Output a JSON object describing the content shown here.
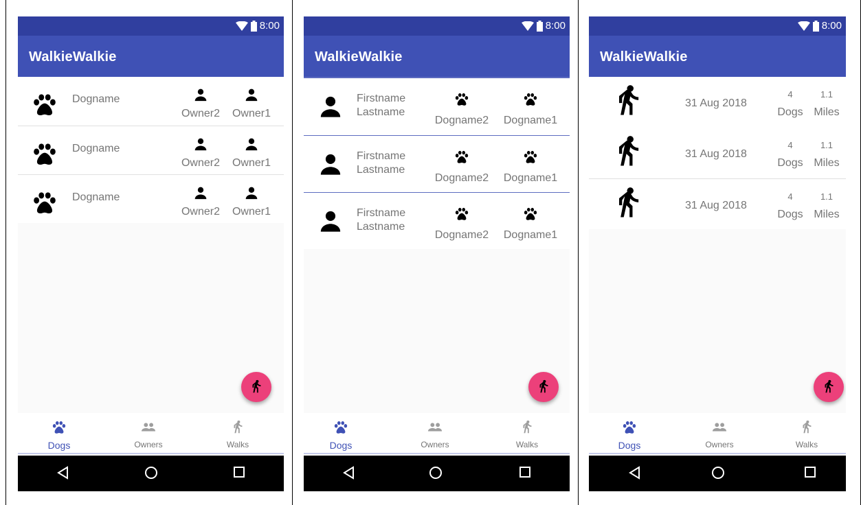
{
  "app": {
    "title": "WalkieWalkie",
    "status_time": "8:00",
    "colors": {
      "primary": "#3f51b5",
      "primary_dark": "#303f9f",
      "accent": "#ec407a"
    }
  },
  "bottom_nav": [
    {
      "label": "Dogs",
      "icon": "paw-icon",
      "active": true
    },
    {
      "label": "Owners",
      "icon": "people-icon",
      "active": false
    },
    {
      "label": "Walks",
      "icon": "walk-icon",
      "active": false
    }
  ],
  "screens": {
    "dogs": {
      "rows": [
        {
          "name": "Dogname",
          "owner_a": "Owner2",
          "owner_b": "Owner1"
        },
        {
          "name": "Dogname",
          "owner_a": "Owner2",
          "owner_b": "Owner1"
        },
        {
          "name": "Dogname",
          "owner_a": "Owner2",
          "owner_b": "Owner1"
        }
      ]
    },
    "owners": {
      "rows": [
        {
          "first": "Firstname",
          "last": "Lastname",
          "dog_a": "Dogname2",
          "dog_b": "Dogname1"
        },
        {
          "first": "Firstname",
          "last": "Lastname",
          "dog_a": "Dogname2",
          "dog_b": "Dogname1"
        },
        {
          "first": "Firstname",
          "last": "Lastname",
          "dog_a": "Dogname2",
          "dog_b": "Dogname1"
        }
      ]
    },
    "walks": {
      "rows": [
        {
          "date": "31 Aug 2018",
          "dogs_count": "4",
          "dogs_unit": "Dogs",
          "miles": "1.1",
          "miles_unit": "Miles"
        },
        {
          "date": "31 Aug 2018",
          "dogs_count": "4",
          "dogs_unit": "Dogs",
          "miles": "1.1",
          "miles_unit": "Miles"
        },
        {
          "date": "31 Aug 2018",
          "dogs_count": "4",
          "dogs_unit": "Dogs",
          "miles": "1.1",
          "miles_unit": "Miles"
        }
      ]
    }
  }
}
